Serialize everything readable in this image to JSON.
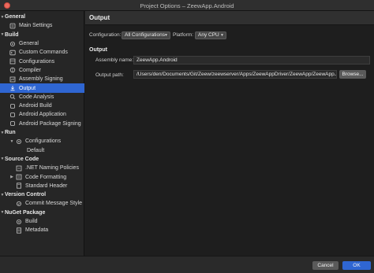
{
  "window": {
    "title": "Project Options – ZeewApp.Android"
  },
  "sidebar": {
    "groups": [
      {
        "label": "General",
        "items": [
          "Main Settings"
        ]
      },
      {
        "label": "Build",
        "items": [
          "General",
          "Custom Commands",
          "Configurations",
          "Compiler",
          "Assembly Signing",
          "Output",
          "Code Analysis",
          "Android Build",
          "Android Application",
          "Android Package Signing"
        ]
      },
      {
        "label": "Run",
        "items": [
          "Configurations",
          "Default"
        ]
      },
      {
        "label": "Source Code",
        "items": [
          ".NET Naming Policies",
          "Code Formatting",
          "Standard Header"
        ]
      },
      {
        "label": "Version Control",
        "items": [
          "Commit Message Style"
        ]
      },
      {
        "label": "NuGet Package",
        "items": [
          "Build",
          "Metadata"
        ]
      }
    ],
    "selected": "Output"
  },
  "main": {
    "header": "Output",
    "configuration_label": "Configuration:",
    "configuration_value": "All Configurations",
    "platform_label": "Platform:",
    "platform_value": "Any CPU",
    "section_title": "Output",
    "assembly_name_label": "Assembly name:",
    "assembly_name_value": "ZeewApp.Android",
    "output_path_label": "Output path:",
    "output_path_value": "/Users/den/Documents/Git/Zeew/zeewserver/Apps/ZeewAppDriver/ZeewApp/ZeewApp.An",
    "browse_label": "Browse..."
  },
  "footer": {
    "cancel_label": "Cancel",
    "ok_label": "OK"
  },
  "colors": {
    "accent": "#2f66d2",
    "close_button": "#ed6a5e"
  },
  "icons": [
    "settings-icon",
    "gear-icon",
    "terminal-icon",
    "config-icon",
    "compiler-icon",
    "signing-icon",
    "output-icon",
    "analysis-icon",
    "android-icon",
    "policy-icon",
    "header-doc-icon",
    "commit-icon",
    "package-doc-icon"
  ]
}
